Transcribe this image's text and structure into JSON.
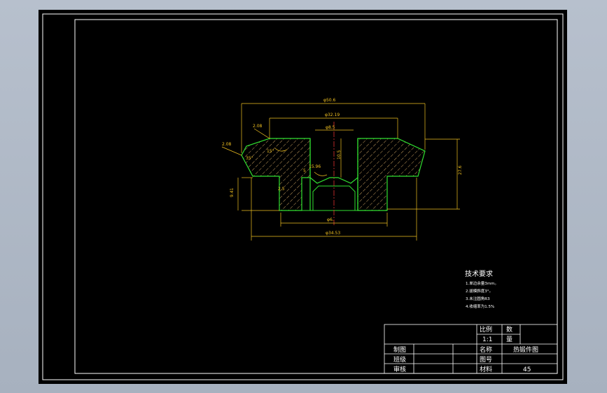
{
  "dimensions": {
    "d_outer": "φ50.6",
    "d_mid": "φ32.19",
    "d_bore": "φ8.5",
    "d_base": "φ34.53",
    "d_inner": "φ6.",
    "chamfer1": "2.08",
    "chamfer2": "2.08",
    "height_total": "27.6",
    "height_bore": "10.5",
    "height_step": "9.41",
    "angle1": "15°",
    "angle2": "35°",
    "small_dim1": "15.96",
    "small_dim2": "5",
    "small_dim3": "2.5"
  },
  "tech_notes": {
    "title": "技术要求",
    "items": [
      "1.单边余量3mm。",
      "2.拔模斜度3°。",
      "3.未注圆角R3",
      "4.收缩率为1.5%"
    ]
  },
  "title_block": {
    "scale_label": "比例",
    "scale_value": "1:1",
    "count_label": "数",
    "count_label2": "量",
    "made_label": "制图",
    "class_label": "班级",
    "check_label": "审核",
    "name_label": "名称",
    "name_value": "热锻件图",
    "drawing_no_label": "图号",
    "material_label": "材料",
    "material_value": "45"
  },
  "colors": {
    "hatch": "#c8a060",
    "outline": "#30e030",
    "dimension": "#f0c020",
    "centerline": "#e03030",
    "frame": "#ffffff"
  }
}
